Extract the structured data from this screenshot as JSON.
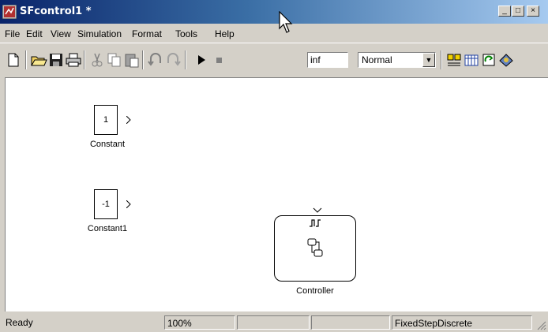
{
  "window": {
    "title": "SFcontrol1 *",
    "minimize_glyph": "_",
    "maximize_glyph": "□",
    "close_glyph": "×"
  },
  "menu": {
    "items": [
      "File",
      "Edit",
      "View",
      "Simulation",
      "Format",
      "Tools",
      "Help"
    ]
  },
  "toolbar": {
    "icons": [
      "new-icon",
      "open-icon",
      "save-icon",
      "print-icon",
      "cut-icon",
      "copy-icon",
      "paste-icon",
      "undo-icon",
      "redo-icon",
      "start-simulation-icon",
      "stop-simulation-icon",
      "library-browser-icon",
      "model-explorer-icon",
      "update-diagram-icon",
      "build-icon"
    ],
    "stop_time": "inf",
    "sim_mode": "Normal"
  },
  "canvas": {
    "blocks": [
      {
        "value": "1",
        "label": "Constant"
      },
      {
        "value": "-1",
        "label": "Constant1"
      }
    ],
    "chart": {
      "label": "Controller"
    }
  },
  "status": {
    "state": "Ready",
    "zoom": "100%",
    "solver": "FixedStepDiscrete"
  },
  "colors": {
    "titlebar_start": "#0a246a",
    "titlebar_end": "#a6caf0",
    "chrome": "#d4d0c8",
    "canvas": "#ffffff"
  }
}
